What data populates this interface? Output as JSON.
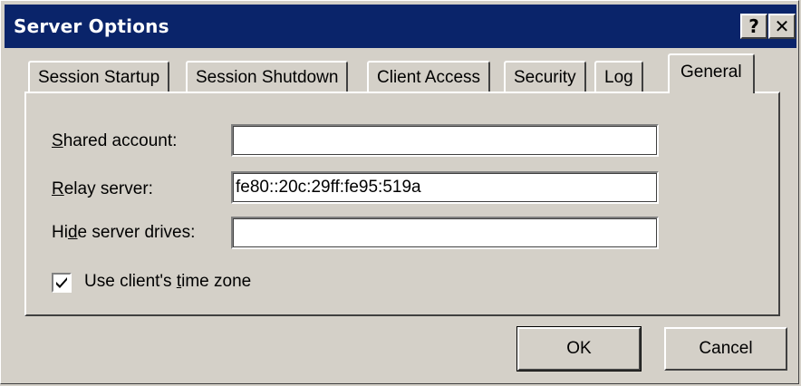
{
  "window": {
    "title": "Server Options",
    "help_glyph": "?",
    "close_glyph": "✕"
  },
  "tabs": [
    {
      "label": "Session Startup",
      "selected": false
    },
    {
      "label": "Session Shutdown",
      "selected": false
    },
    {
      "label": "Client Access",
      "selected": false
    },
    {
      "label": "Security",
      "selected": false
    },
    {
      "label": "Log",
      "selected": false
    },
    {
      "label": "General",
      "selected": true
    }
  ],
  "general": {
    "shared_account": {
      "label_mnemonic": "S",
      "label_rest": "hared account:",
      "value": ""
    },
    "relay_server": {
      "label_mnemonic": "R",
      "label_rest": "elay server:",
      "value": "fe80::20c:29ff:fe95:519a"
    },
    "hide_server_drives": {
      "label_pre": "Hi",
      "label_mnemonic": "d",
      "label_rest": "e server drives:",
      "value": ""
    },
    "use_client_time_zone": {
      "label_pre": "Use client's ",
      "label_mnemonic": "t",
      "label_rest": "ime zone",
      "checked": true
    }
  },
  "buttons": {
    "ok": "OK",
    "cancel": "Cancel"
  },
  "colors": {
    "titlebar": "#0a246a",
    "face": "#d4d0c8"
  }
}
